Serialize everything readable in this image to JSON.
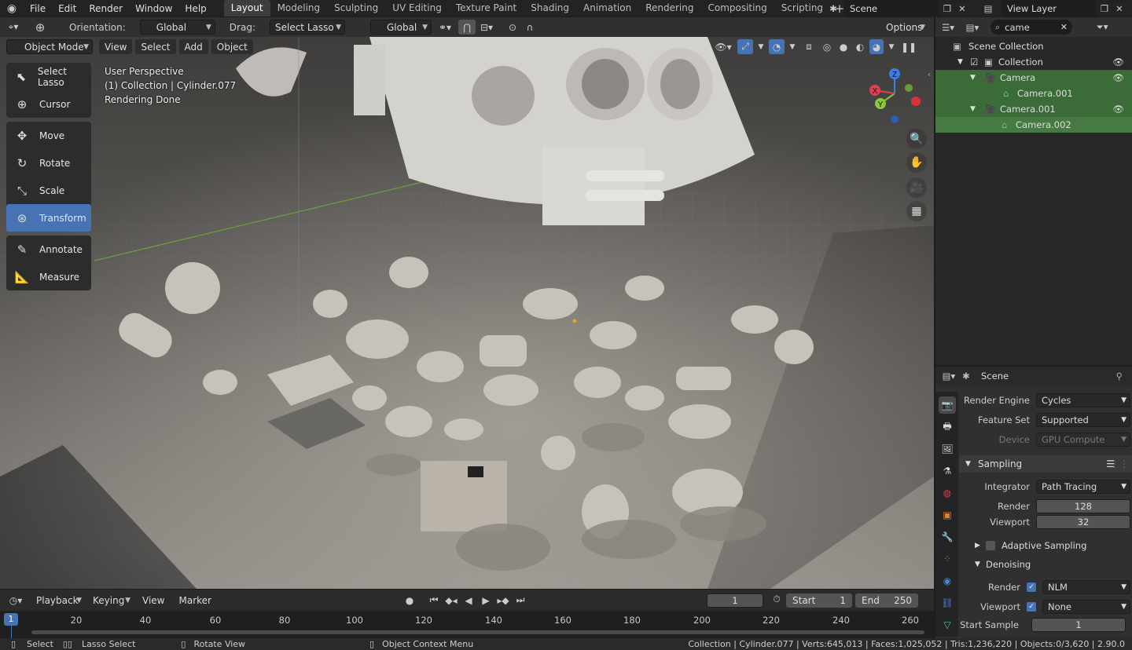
{
  "topbar": {
    "menus": [
      "File",
      "Edit",
      "Render",
      "Window",
      "Help"
    ],
    "workspaces": [
      "Layout",
      "Modeling",
      "Sculpting",
      "UV Editing",
      "Texture Paint",
      "Shading",
      "Animation",
      "Rendering",
      "Compositing",
      "Scripting"
    ],
    "active_workspace": "Layout",
    "scene_name": "Scene",
    "view_layer": "View Layer"
  },
  "viewport_header": {
    "orientation_label": "Orientation:",
    "orientation_value": "Global",
    "drag_label": "Drag:",
    "drag_value": "Select Lasso",
    "transform_orientation": "Global",
    "options_label": "Options"
  },
  "viewport_sub": {
    "mode": "Object Mode",
    "menus": [
      "View",
      "Select",
      "Add",
      "Object"
    ]
  },
  "overlay_text": {
    "line1": "User Perspective",
    "line2": "(1) Collection | Cylinder.077",
    "line3": "Rendering Done"
  },
  "toolbar": [
    {
      "label": "Select Lasso",
      "icon": "lasso-select-icon"
    },
    {
      "label": "Cursor",
      "icon": "cursor-icon"
    },
    {
      "label": "Move",
      "icon": "move-icon"
    },
    {
      "label": "Rotate",
      "icon": "rotate-icon"
    },
    {
      "label": "Scale",
      "icon": "scale-icon"
    },
    {
      "label": "Transform",
      "icon": "transform-icon",
      "active": true
    },
    {
      "label": "Annotate",
      "icon": "annotate-icon"
    },
    {
      "label": "Measure",
      "icon": "measure-icon"
    }
  ],
  "gizmo": {
    "x": "X",
    "y": "Y",
    "z": "Z"
  },
  "timeline": {
    "menus": [
      "Playback",
      "Keying",
      "View",
      "Marker"
    ],
    "current_frame": "1",
    "start_label": "Start",
    "start_value": "1",
    "end_label": "End",
    "end_value": "250",
    "ruler_marks": [
      "20",
      "40",
      "60",
      "80",
      "100",
      "120",
      "140",
      "160",
      "180",
      "200",
      "220",
      "240",
      "260"
    ],
    "playhead": "1"
  },
  "statusbar": {
    "select": "Select",
    "lasso": "Lasso Select",
    "rotate": "Rotate View",
    "context": "Object Context Menu",
    "stats": "Collection | Cylinder.077 | Verts:645,013 | Faces:1,025,052 | Tris:1,236,220 | Objects:0/3,620 | 2.90.0"
  },
  "outliner": {
    "search_value": "came",
    "rows": [
      {
        "label": "Scene Collection",
        "indent": 0,
        "selected": false
      },
      {
        "label": "Collection",
        "indent": 1,
        "selected": false
      },
      {
        "label": "Camera",
        "indent": 2,
        "selected": true
      },
      {
        "label": "Camera.001",
        "indent": 3,
        "selected": true
      },
      {
        "label": "Camera.001",
        "indent": 2,
        "selected": true
      },
      {
        "label": "Camera.002",
        "indent": 3,
        "selected": true
      }
    ]
  },
  "properties": {
    "header_title": "Scene",
    "render_engine_label": "Render Engine",
    "render_engine": "Cycles",
    "feature_set_label": "Feature Set",
    "feature_set": "Supported",
    "device_label": "Device",
    "device": "GPU Compute",
    "sampling_label": "Sampling",
    "integrator_label": "Integrator",
    "integrator": "Path Tracing",
    "render_label": "Render",
    "render_samples": "128",
    "viewport_label": "Viewport",
    "viewport_samples": "32",
    "adaptive_label": "Adaptive Sampling",
    "denoising_label": "Denoising",
    "denoise_render_label": "Render",
    "denoise_render": "NLM",
    "denoise_viewport_label": "Viewport",
    "denoise_viewport": "None",
    "start_sample_label": "Start Sample",
    "start_sample": "1"
  },
  "colors": {
    "accent": "#4772b3",
    "selected_row": "#3b6b38",
    "axis_x": "#e04050",
    "axis_y": "#8ac840",
    "axis_z": "#3e7fe0"
  }
}
